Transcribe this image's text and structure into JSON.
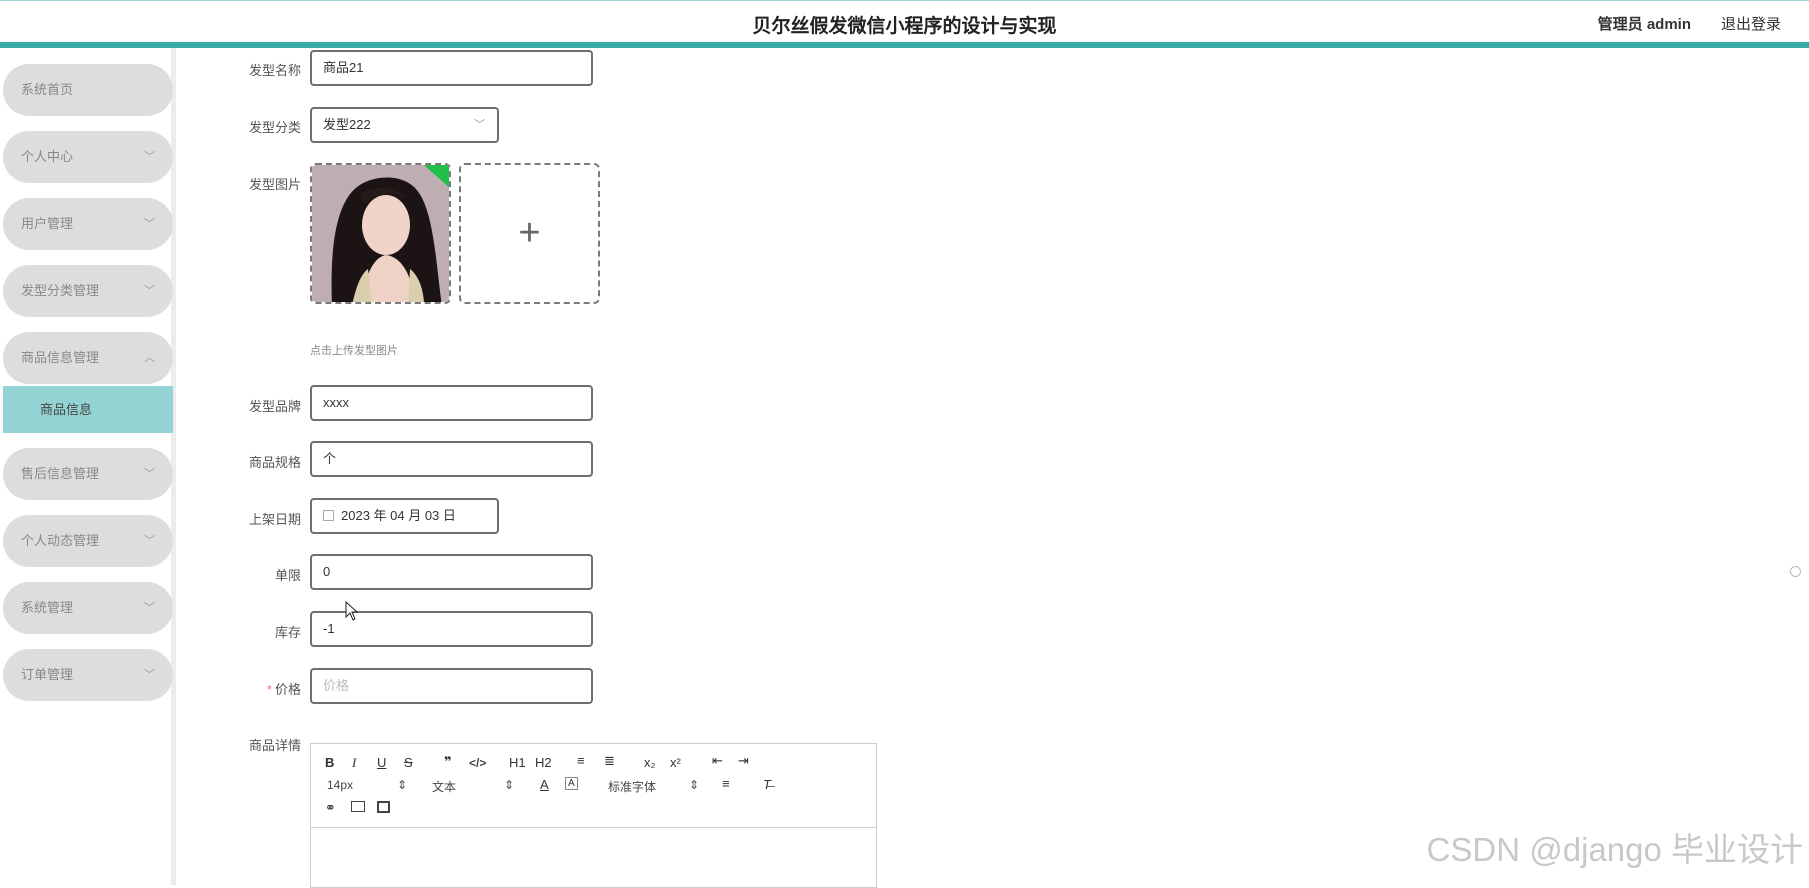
{
  "header": {
    "title": "贝尔丝假发微信小程序的设计与实现",
    "user": "管理员 admin",
    "logout": "退出登录"
  },
  "sidebar": {
    "items": [
      {
        "label": "系统首页",
        "has_arrow": false
      },
      {
        "label": "个人中心",
        "has_arrow": true
      },
      {
        "label": "用户管理",
        "has_arrow": true
      },
      {
        "label": "发型分类管理",
        "has_arrow": true
      },
      {
        "label": "商品信息管理",
        "has_arrow": true,
        "expanded": true
      },
      {
        "label": "售后信息管理",
        "has_arrow": true
      },
      {
        "label": "个人动态管理",
        "has_arrow": true
      },
      {
        "label": "系统管理",
        "has_arrow": true
      },
      {
        "label": "订单管理",
        "has_arrow": true
      }
    ],
    "submenu": {
      "label": "商品信息",
      "active": true
    }
  },
  "form": {
    "name": {
      "label": "发型名称",
      "value": "商品21"
    },
    "category": {
      "label": "发型分类",
      "value": "发型222"
    },
    "image": {
      "label": "发型图片",
      "hint": "点击上传发型图片"
    },
    "brand": {
      "label": "发型品牌",
      "value": "xxxx"
    },
    "spec": {
      "label": "商品规格",
      "value": "个"
    },
    "date": {
      "label": "上架日期",
      "value": "2023 年 04 月 03 日"
    },
    "limit": {
      "label": "单限",
      "value": "0"
    },
    "stock": {
      "label": "库存",
      "value": "-1"
    },
    "price": {
      "label": "价格",
      "placeholder": "价格",
      "required": true
    },
    "detail": {
      "label": "商品详情"
    }
  },
  "editor": {
    "font_size": "14px",
    "text_type": "文本",
    "font_family": "标准字体",
    "buttons": [
      "B",
      "I",
      "U",
      "S",
      "❞",
      "</>",
      "H1",
      "H2",
      "≡",
      "≣",
      "x₂",
      "x²",
      "⇤",
      "⇥"
    ]
  },
  "watermark": "CSDN @django 毕业设计",
  "colors": {
    "accent": "#3aa8a6",
    "submenu_active": "#93d3d4",
    "menu_bg": "#dedcdf"
  }
}
